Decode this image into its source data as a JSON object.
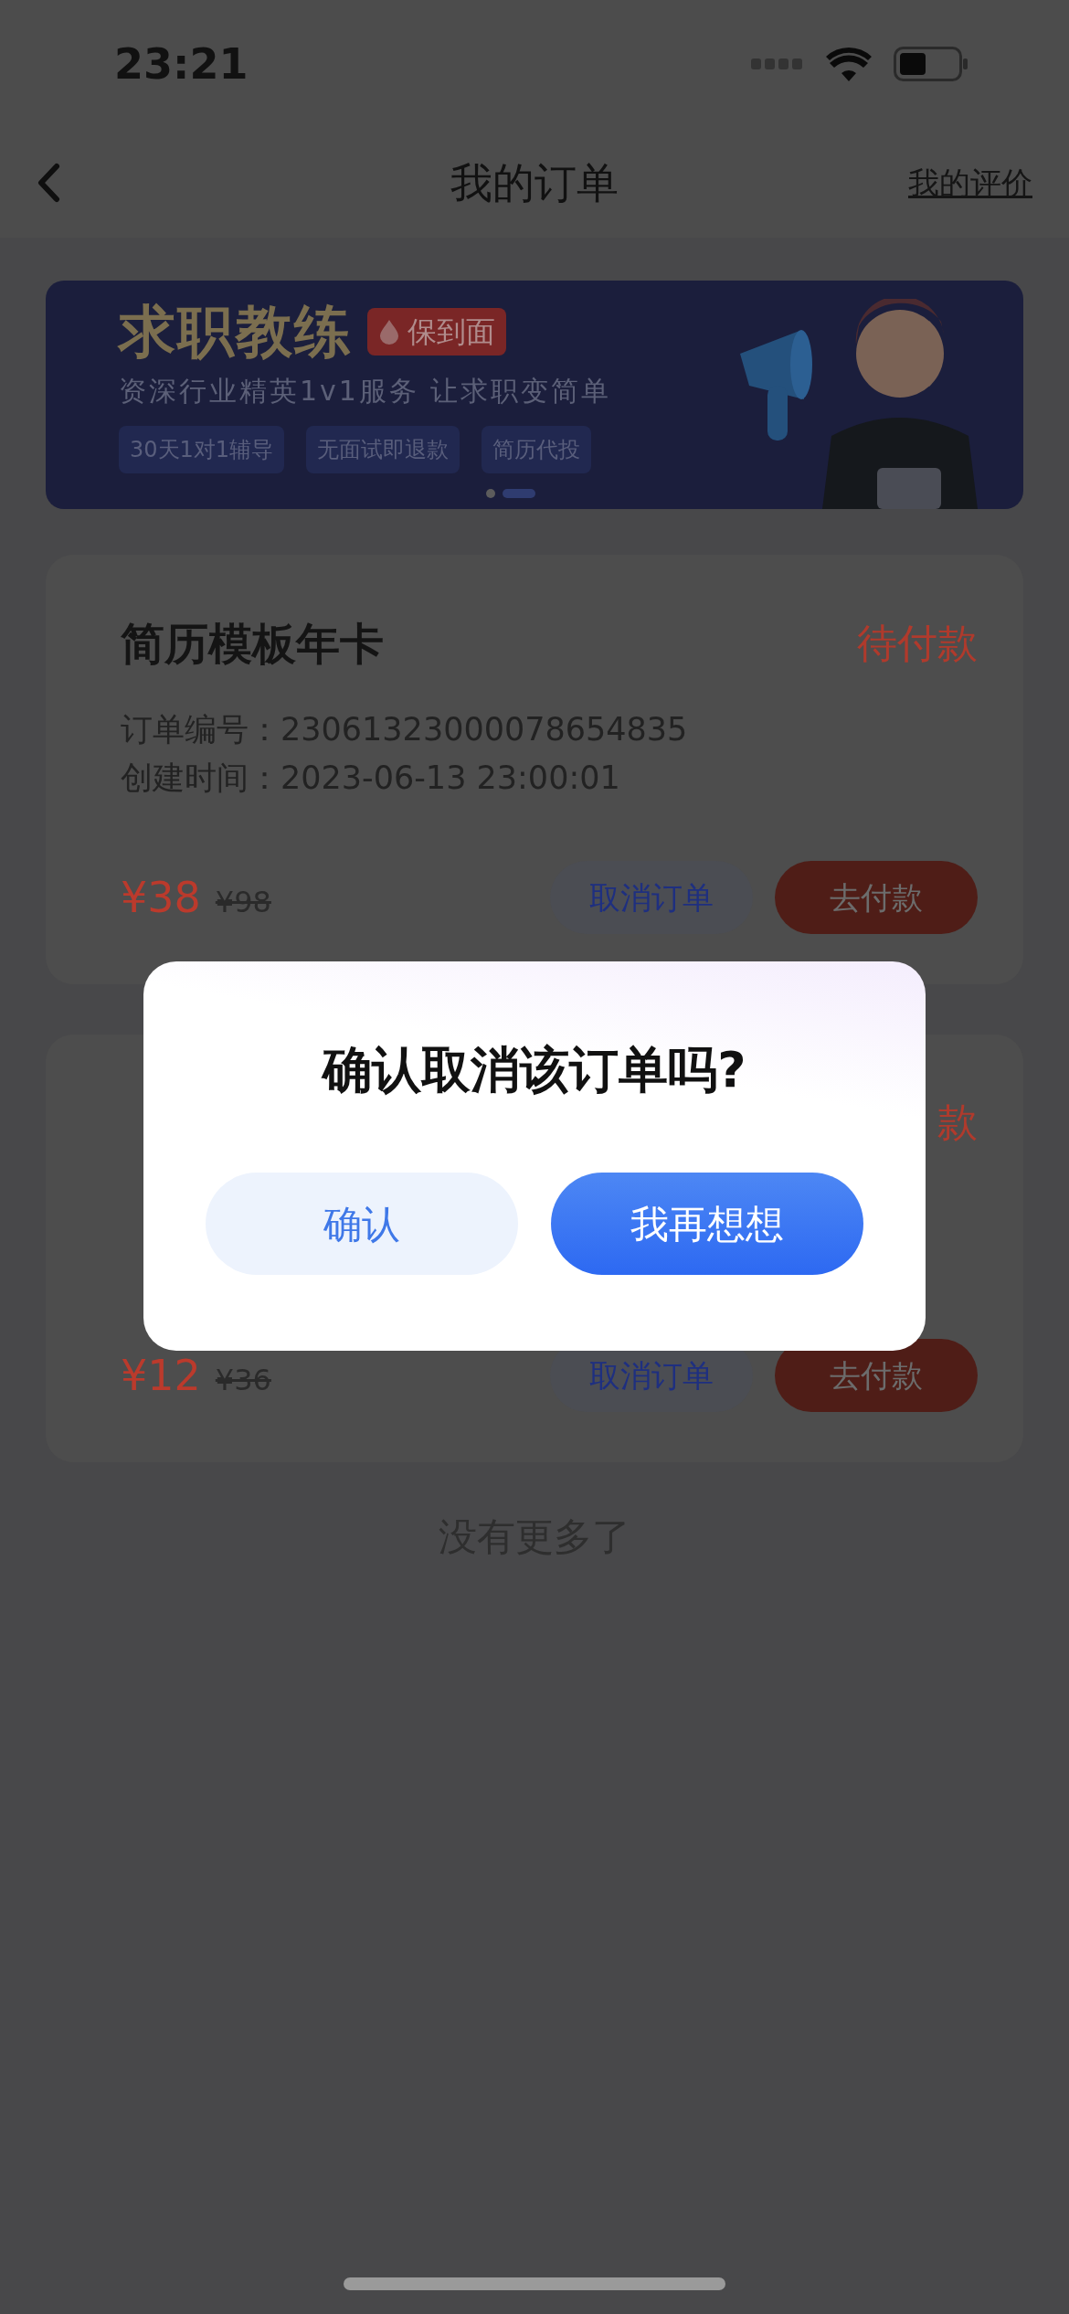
{
  "status_bar": {
    "time": "23:21"
  },
  "nav": {
    "title": "我的订单",
    "action": "我的评价"
  },
  "banner": {
    "title": "求职教练",
    "badge": "保到面",
    "subtitle": "资深行业精英1v1服务 让求职变简单",
    "features": [
      "30天1对1辅导",
      "无面试即退款",
      "简历代投"
    ],
    "dots": [
      {
        "selected": false
      },
      {
        "selected": true
      }
    ]
  },
  "orders": [
    {
      "title": "简历模板年卡",
      "status": "待付款",
      "lines": [
        "订单编号：23061323000078654835",
        "创建时间：2023-06-13 23:00:01"
      ],
      "price": "¥38",
      "original_price": "¥98",
      "buttons": [
        "取消订单",
        "去付款"
      ]
    },
    {
      "status": "款",
      "price": "¥12",
      "original_price": "¥36",
      "buttons": [
        "取消订单",
        "去付款"
      ]
    }
  ],
  "footer": "没有更多了",
  "dialog": {
    "title": "确认取消该订单吗?",
    "buttons": [
      {
        "label": "确认",
        "kind": "secondary"
      },
      {
        "label": "我再想想",
        "kind": "primary"
      }
    ]
  }
}
